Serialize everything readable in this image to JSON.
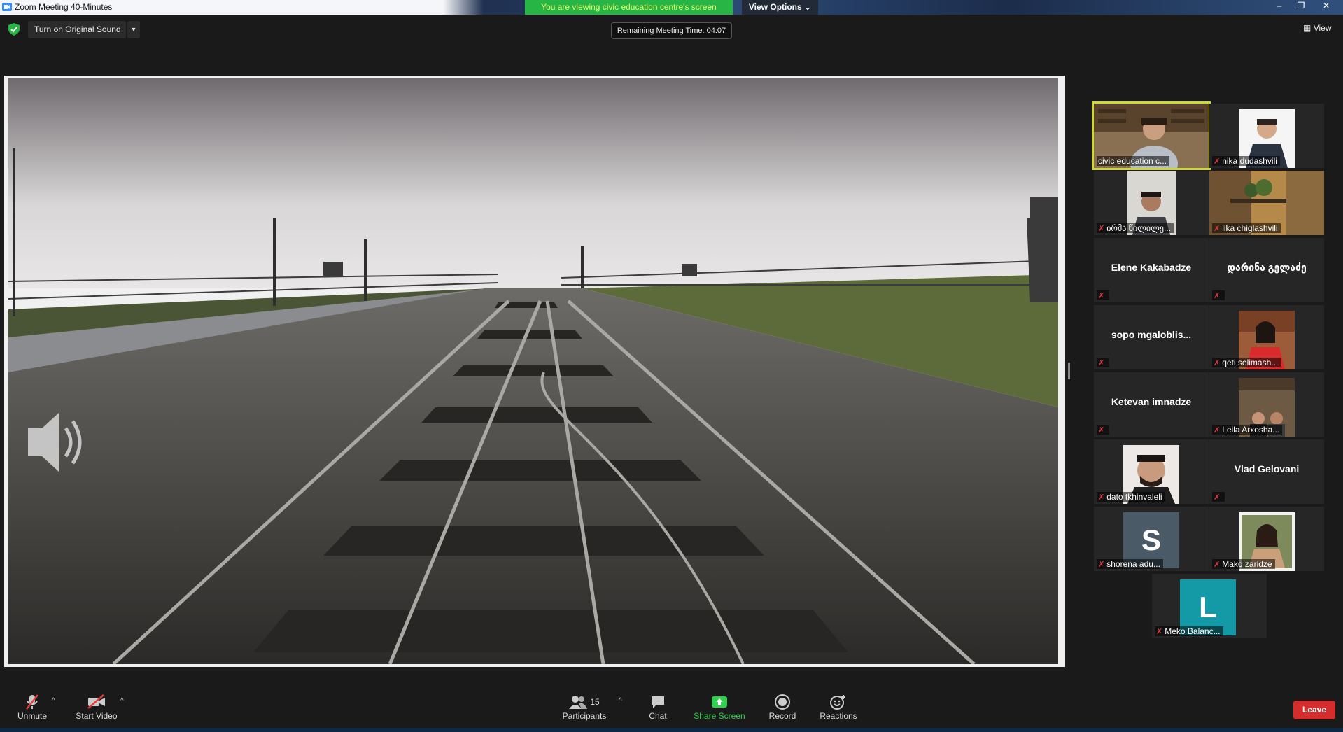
{
  "window": {
    "title": "Zoom Meeting 40-Minutes",
    "share_banner": "You are viewing civic education centre's screen",
    "view_options": "View Options",
    "controls": [
      "–",
      "❐",
      "✕"
    ]
  },
  "topbar": {
    "original_sound": "Turn on Original Sound",
    "remaining": "Remaining Meeting Time: 04:07",
    "view": "View"
  },
  "participants": [
    {
      "name": "civic education c...",
      "video": true,
      "active": true
    },
    {
      "name": "nika dudashvili",
      "video": true,
      "muted": true
    },
    {
      "name": "ირმა წილილე...",
      "video": true,
      "muted": true
    },
    {
      "name": "lika chiglashvili",
      "video": true,
      "muted": true
    },
    {
      "name": "Elene Kakabadze",
      "video": false,
      "muted": true
    },
    {
      "name": "დარინა გელაძე",
      "video": false,
      "muted": true
    },
    {
      "name": "sopo  mgaloblis...",
      "video": false,
      "muted": true
    },
    {
      "name": "qeti selimash...",
      "video": true,
      "muted": true
    },
    {
      "name": "Ketevan imnadze",
      "video": false,
      "muted": true
    },
    {
      "name": "Leila Arxosha...",
      "video": true,
      "muted": true
    },
    {
      "name": "dato tkhinvaleli",
      "video": true,
      "muted": true
    },
    {
      "name": "Vlad Gelovani",
      "video": false,
      "muted": true
    },
    {
      "name": "shorena adu...",
      "avatar": "S",
      "muted": true
    },
    {
      "name": "Mako zaridze",
      "video": true,
      "muted": true
    },
    {
      "name": "Meko Balanc...",
      "avatar": "L",
      "muted": true
    }
  ],
  "toolbar": {
    "unmute": "Unmute",
    "start_video": "Start Video",
    "participants": "Participants",
    "participant_count": "15",
    "chat": "Chat",
    "share_screen": "Share Screen",
    "record": "Record",
    "reactions": "Reactions",
    "leave": "Leave"
  },
  "colors": {
    "share_banner_bg": "#27b545",
    "share_banner_text": "#e9ff6a",
    "active_speaker": "#cdd833",
    "leave": "#d42d2d",
    "share_green": "#2dd14b",
    "mute_red": "#e53b3b",
    "avatar_s": "#4a5a66",
    "avatar_l": "#149aa6"
  }
}
